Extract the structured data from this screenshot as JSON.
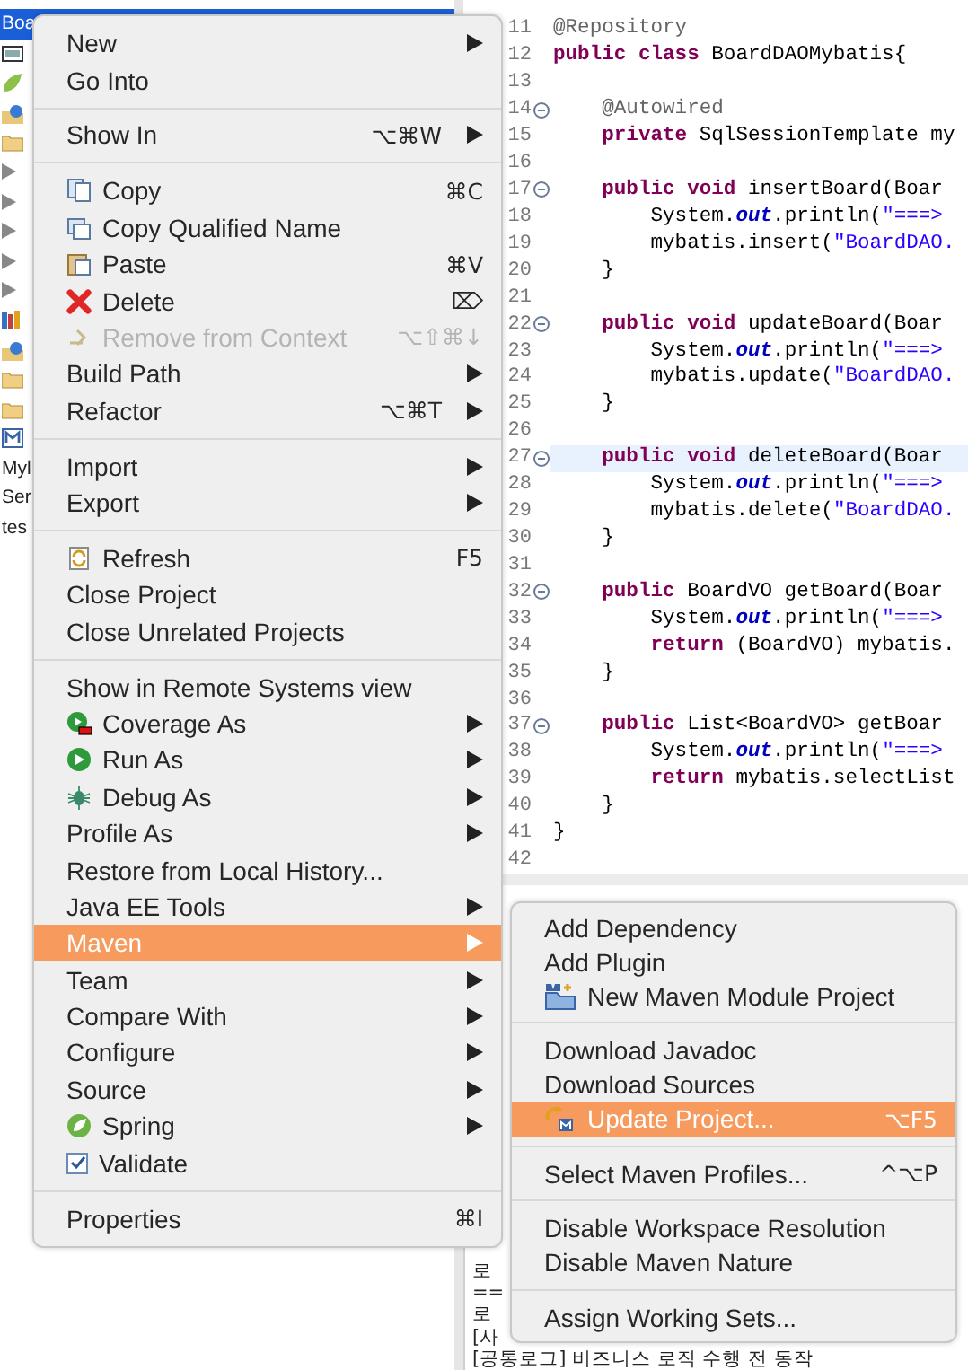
{
  "explorer": {
    "rows": [
      {
        "kind": "label",
        "label": "Boa",
        "selected": true
      },
      {
        "kind": "jar",
        "selected": false
      },
      {
        "kind": "leaf",
        "selected": false
      },
      {
        "kind": "globe",
        "selected": false
      },
      {
        "kind": "folder",
        "selected": false
      },
      {
        "kind": "expander",
        "selected": false
      },
      {
        "kind": "expander",
        "selected": false
      },
      {
        "kind": "expander",
        "selected": false
      },
      {
        "kind": "expander",
        "selected": false
      },
      {
        "kind": "expander",
        "selected": false
      },
      {
        "kind": "books",
        "selected": false
      },
      {
        "kind": "globe",
        "selected": false
      },
      {
        "kind": "folder",
        "selected": false
      },
      {
        "kind": "folder",
        "selected": false
      },
      {
        "kind": "module",
        "selected": false
      },
      {
        "kind": "label",
        "label": "Myl",
        "selected": false
      },
      {
        "kind": "label",
        "label": "Ser",
        "selected": false
      },
      {
        "kind": "label",
        "label": "tes",
        "selected": false
      }
    ]
  },
  "editor": {
    "lines": [
      {
        "number": "11",
        "fold": false,
        "current": false,
        "segments": [
          {
            "kind": "annotation",
            "text": "@Repository"
          }
        ]
      },
      {
        "number": "12",
        "fold": false,
        "current": false,
        "segments": [
          {
            "kind": "keyword",
            "text": "public class "
          },
          {
            "kind": "plain",
            "text": "BoardDAOMybatis{"
          }
        ]
      },
      {
        "number": "13",
        "fold": false,
        "current": false
      },
      {
        "number": "14",
        "fold": true,
        "current": false,
        "segments": [
          {
            "kind": "annotation",
            "text": "    @Autowired"
          }
        ]
      },
      {
        "number": "15",
        "fold": false,
        "current": false,
        "segments": [
          {
            "kind": "keyword",
            "text": "    private "
          },
          {
            "kind": "plain",
            "text": "SqlSessionTemplate my"
          }
        ]
      },
      {
        "number": "16",
        "fold": false,
        "current": false
      },
      {
        "number": "17",
        "fold": true,
        "current": false,
        "segments": [
          {
            "kind": "keyword",
            "text": "    public void "
          },
          {
            "kind": "plain",
            "text": "insertBoard(Boar"
          }
        ]
      },
      {
        "number": "18",
        "fold": false,
        "current": false,
        "segments": [
          {
            "kind": "plain",
            "text": "        System."
          },
          {
            "kind": "field",
            "text": "out"
          },
          {
            "kind": "plain",
            "text": ".println("
          },
          {
            "kind": "string",
            "text": "\"===>"
          }
        ]
      },
      {
        "number": "19",
        "fold": false,
        "current": false,
        "segments": [
          {
            "kind": "plain",
            "text": "        mybatis.insert("
          },
          {
            "kind": "string",
            "text": "\"BoardDAO."
          }
        ]
      },
      {
        "number": "20",
        "fold": false,
        "current": false,
        "segments": [
          {
            "kind": "plain",
            "text": "    }"
          }
        ]
      },
      {
        "number": "21",
        "fold": false,
        "current": false
      },
      {
        "number": "22",
        "fold": true,
        "current": false,
        "segments": [
          {
            "kind": "keyword",
            "text": "    public void "
          },
          {
            "kind": "plain",
            "text": "updateBoard(Boar"
          }
        ]
      },
      {
        "number": "23",
        "fold": false,
        "current": false,
        "segments": [
          {
            "kind": "plain",
            "text": "        System."
          },
          {
            "kind": "field",
            "text": "out"
          },
          {
            "kind": "plain",
            "text": ".println("
          },
          {
            "kind": "string",
            "text": "\"===>"
          }
        ]
      },
      {
        "number": "24",
        "fold": false,
        "current": false,
        "segments": [
          {
            "kind": "plain",
            "text": "        mybatis.update("
          },
          {
            "kind": "string",
            "text": "\"BoardDAO."
          }
        ]
      },
      {
        "number": "25",
        "fold": false,
        "current": false,
        "segments": [
          {
            "kind": "plain",
            "text": "    }"
          }
        ]
      },
      {
        "number": "26",
        "fold": false,
        "current": false
      },
      {
        "number": "27",
        "fold": true,
        "current": true,
        "segments": [
          {
            "kind": "keyword",
            "text": "    public void "
          },
          {
            "kind": "plain",
            "text": "deleteBoard(Boar"
          }
        ]
      },
      {
        "number": "28",
        "fold": false,
        "current": false,
        "segments": [
          {
            "kind": "plain",
            "text": "        System."
          },
          {
            "kind": "field",
            "text": "out"
          },
          {
            "kind": "plain",
            "text": ".println("
          },
          {
            "kind": "string",
            "text": "\"===>"
          }
        ]
      },
      {
        "number": "29",
        "fold": false,
        "current": false,
        "segments": [
          {
            "kind": "plain",
            "text": "        mybatis.delete("
          },
          {
            "kind": "string",
            "text": "\"BoardDAO."
          }
        ]
      },
      {
        "number": "30",
        "fold": false,
        "current": false,
        "segments": [
          {
            "kind": "plain",
            "text": "    }"
          }
        ]
      },
      {
        "number": "31",
        "fold": false,
        "current": false
      },
      {
        "number": "32",
        "fold": true,
        "current": false,
        "segments": [
          {
            "kind": "keyword",
            "text": "    public "
          },
          {
            "kind": "plain",
            "text": "BoardVO getBoard(Boar"
          }
        ]
      },
      {
        "number": "33",
        "fold": false,
        "current": false,
        "segments": [
          {
            "kind": "plain",
            "text": "        System."
          },
          {
            "kind": "field",
            "text": "out"
          },
          {
            "kind": "plain",
            "text": ".println("
          },
          {
            "kind": "string",
            "text": "\"===>"
          }
        ]
      },
      {
        "number": "34",
        "fold": false,
        "current": false,
        "segments": [
          {
            "kind": "keyword",
            "text": "        return "
          },
          {
            "kind": "plain",
            "text": "(BoardVO) mybatis."
          }
        ]
      },
      {
        "number": "35",
        "fold": false,
        "current": false,
        "segments": [
          {
            "kind": "plain",
            "text": "    }"
          }
        ]
      },
      {
        "number": "36",
        "fold": false,
        "current": false
      },
      {
        "number": "37",
        "fold": true,
        "current": false,
        "segments": [
          {
            "kind": "keyword",
            "text": "    public "
          },
          {
            "kind": "plain",
            "text": "List<BoardVO> getBoar"
          }
        ]
      },
      {
        "number": "38",
        "fold": false,
        "current": false,
        "segments": [
          {
            "kind": "plain",
            "text": "        System."
          },
          {
            "kind": "field",
            "text": "out"
          },
          {
            "kind": "plain",
            "text": ".println("
          },
          {
            "kind": "string",
            "text": "\"===>"
          }
        ]
      },
      {
        "number": "39",
        "fold": false,
        "current": false,
        "segments": [
          {
            "kind": "keyword",
            "text": "        return "
          },
          {
            "kind": "plain",
            "text": "mybatis.selectList"
          }
        ]
      },
      {
        "number": "40",
        "fold": false,
        "current": false,
        "segments": [
          {
            "kind": "plain",
            "text": "    }"
          }
        ]
      },
      {
        "number": "41",
        "fold": false,
        "current": false,
        "segments": [
          {
            "kind": "plain",
            "text": "}"
          }
        ]
      },
      {
        "number": "42",
        "fold": false,
        "current": false
      }
    ]
  },
  "console": {
    "lines": [
      "로",
      "==",
      "로",
      "[사",
      "[공통로그] 비즈니스 로직 수행 전 동작"
    ]
  },
  "context_menu": {
    "items": [
      {
        "kind": "text",
        "label": "New",
        "submenu": true,
        "selected": false,
        "disabled": false
      },
      {
        "kind": "text",
        "label": "Go Into",
        "submenu": false,
        "selected": false,
        "disabled": false
      },
      {
        "kind": "separator"
      },
      {
        "kind": "text",
        "label": "Show In",
        "shortcut": "⌥⌘W",
        "submenu": true,
        "selected": false,
        "disabled": false
      },
      {
        "kind": "separator"
      },
      {
        "kind": "copy",
        "label": "Copy",
        "shortcut": "⌘C",
        "submenu": false,
        "selected": false,
        "disabled": false
      },
      {
        "kind": "qualified",
        "label": "Copy Qualified Name",
        "submenu": false,
        "selected": false,
        "disabled": false
      },
      {
        "kind": "paste",
        "label": "Paste",
        "shortcut": "⌘V",
        "submenu": false,
        "selected": false,
        "disabled": false
      },
      {
        "kind": "delete",
        "label": "Delete",
        "shortcut": "⌦",
        "submenu": false,
        "selected": false,
        "disabled": false
      },
      {
        "kind": "remove",
        "label": "Remove from Context",
        "shortcut": "⌥⇧⌘↓",
        "submenu": false,
        "selected": false,
        "disabled": true
      },
      {
        "kind": "text",
        "label": "Build Path",
        "submenu": true,
        "selected": false,
        "disabled": false
      },
      {
        "kind": "text",
        "label": "Refactor",
        "shortcut": "⌥⌘T",
        "submenu": true,
        "selected": false,
        "disabled": false
      },
      {
        "kind": "separator"
      },
      {
        "kind": "text",
        "label": "Import",
        "submenu": true,
        "selected": false,
        "disabled": false
      },
      {
        "kind": "text",
        "label": "Export",
        "submenu": true,
        "selected": false,
        "disabled": false
      },
      {
        "kind": "separator"
      },
      {
        "kind": "refresh",
        "label": "Refresh",
        "shortcut": "F5",
        "submenu": false,
        "selected": false,
        "disabled": false
      },
      {
        "kind": "text",
        "label": "Close Project",
        "submenu": false,
        "selected": false,
        "disabled": false
      },
      {
        "kind": "text",
        "label": "Close Unrelated Projects",
        "submenu": false,
        "selected": false,
        "disabled": false
      },
      {
        "kind": "separator"
      },
      {
        "kind": "text",
        "label": "Show in Remote Systems view",
        "submenu": false,
        "selected": false,
        "disabled": false
      },
      {
        "kind": "coverage",
        "label": "Coverage As",
        "submenu": true,
        "selected": false,
        "disabled": false
      },
      {
        "kind": "run",
        "label": "Run As",
        "submenu": true,
        "selected": false,
        "disabled": false
      },
      {
        "kind": "debug",
        "label": "Debug As",
        "submenu": true,
        "selected": false,
        "disabled": false
      },
      {
        "kind": "text",
        "label": "Profile As",
        "submenu": true,
        "selected": false,
        "disabled": false
      },
      {
        "kind": "text",
        "label": "Restore from Local History...",
        "submenu": false,
        "selected": false,
        "disabled": false
      },
      {
        "kind": "text",
        "label": "Java EE Tools",
        "submenu": true,
        "selected": false,
        "disabled": false
      },
      {
        "kind": "text",
        "label": "Maven",
        "submenu": true,
        "selected": true,
        "disabled": false
      },
      {
        "kind": "text",
        "label": "Team",
        "submenu": true,
        "selected": false,
        "disabled": false
      },
      {
        "kind": "text",
        "label": "Compare With",
        "submenu": true,
        "selected": false,
        "disabled": false
      },
      {
        "kind": "text",
        "label": "Configure",
        "submenu": true,
        "selected": false,
        "disabled": false
      },
      {
        "kind": "text",
        "label": "Source",
        "submenu": true,
        "selected": false,
        "disabled": false
      },
      {
        "kind": "spring",
        "label": "Spring",
        "submenu": true,
        "selected": false,
        "disabled": false
      },
      {
        "kind": "checkbox",
        "label": "Validate",
        "checked": true,
        "submenu": false,
        "selected": false,
        "disabled": false
      },
      {
        "kind": "separator"
      },
      {
        "kind": "text",
        "label": "Properties",
        "shortcut": "⌘I",
        "submenu": false,
        "selected": false,
        "disabled": false
      }
    ]
  },
  "maven_submenu": {
    "items": [
      {
        "kind": "text",
        "label": "Add Dependency",
        "selected": false
      },
      {
        "kind": "text",
        "label": "Add Plugin",
        "selected": false
      },
      {
        "kind": "module",
        "label": "New Maven Module Project",
        "selected": false
      },
      {
        "kind": "separator"
      },
      {
        "kind": "text",
        "label": "Download Javadoc",
        "selected": false
      },
      {
        "kind": "text",
        "label": "Download Sources",
        "selected": false
      },
      {
        "kind": "update",
        "label": "Update Project...",
        "shortcut": "⌥F5",
        "selected": true
      },
      {
        "kind": "separator"
      },
      {
        "kind": "text",
        "label": "Select Maven Profiles...",
        "shortcut": "^⌥P",
        "selected": false
      },
      {
        "kind": "separator"
      },
      {
        "kind": "text",
        "label": "Disable Workspace Resolution",
        "selected": false
      },
      {
        "kind": "text",
        "label": "Disable Maven Nature",
        "selected": false
      },
      {
        "kind": "separator"
      },
      {
        "kind": "text",
        "label": "Assign Working Sets...",
        "selected": false
      }
    ]
  }
}
